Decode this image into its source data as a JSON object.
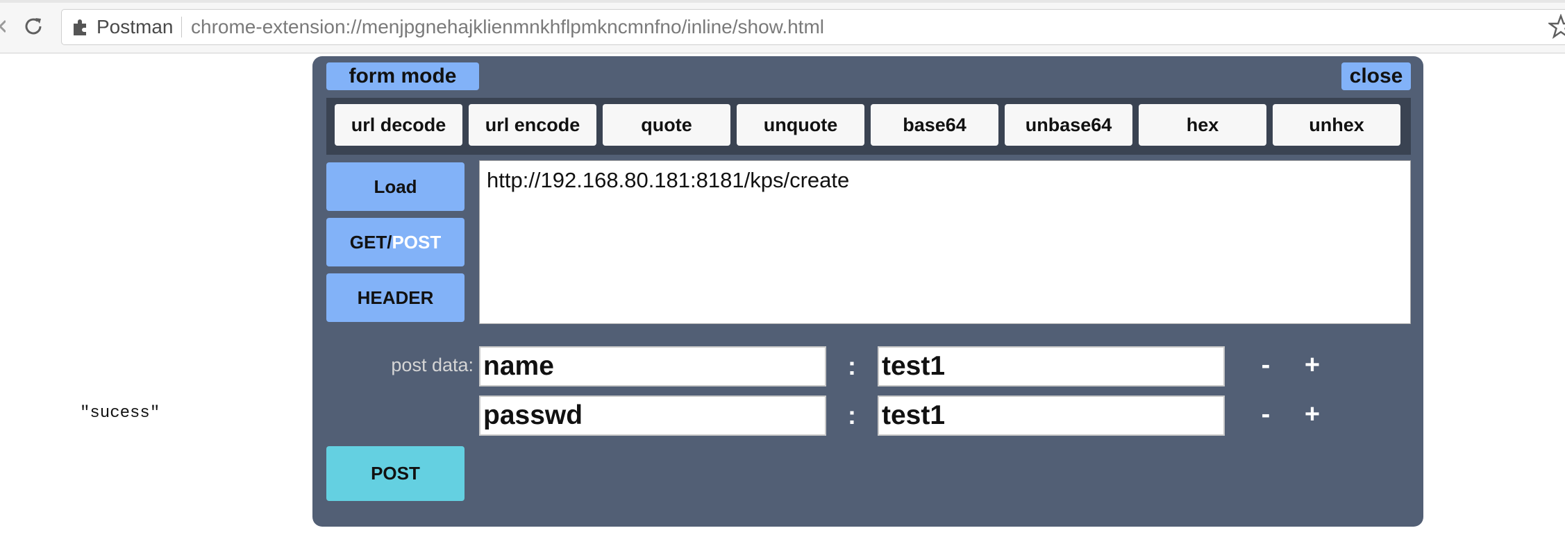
{
  "browser": {
    "extension_name": "Postman",
    "url": "chrome-extension://menjpgnehajklienmnkhflpmkncmnfno/inline/show.html"
  },
  "response_text": "\"sucess\"",
  "panel": {
    "form_mode_label": "form mode",
    "close_label": "close",
    "tools": [
      "url decode",
      "url encode",
      "quote",
      "unquote",
      "base64",
      "unbase64",
      "hex",
      "unhex"
    ],
    "load_label": "Load",
    "method_get": "GET/",
    "method_post": "POST",
    "header_label": "HEADER",
    "url_value": "http://192.168.80.181:8181/kps/create",
    "post_data_label": "post data:",
    "rows": [
      {
        "key": "name",
        "value": "test1",
        "colon": ":",
        "minus": "-",
        "plus": "+"
      },
      {
        "key": "passwd",
        "value": "test1",
        "colon": ":",
        "minus": "-",
        "plus": "+"
      }
    ],
    "submit_label": "POST"
  },
  "colors": {
    "panel_bg": "#525f75",
    "accent_blue": "#82b2f8",
    "accent_cyan": "#64d0e1",
    "toolbar_bg": "#3a4352"
  }
}
